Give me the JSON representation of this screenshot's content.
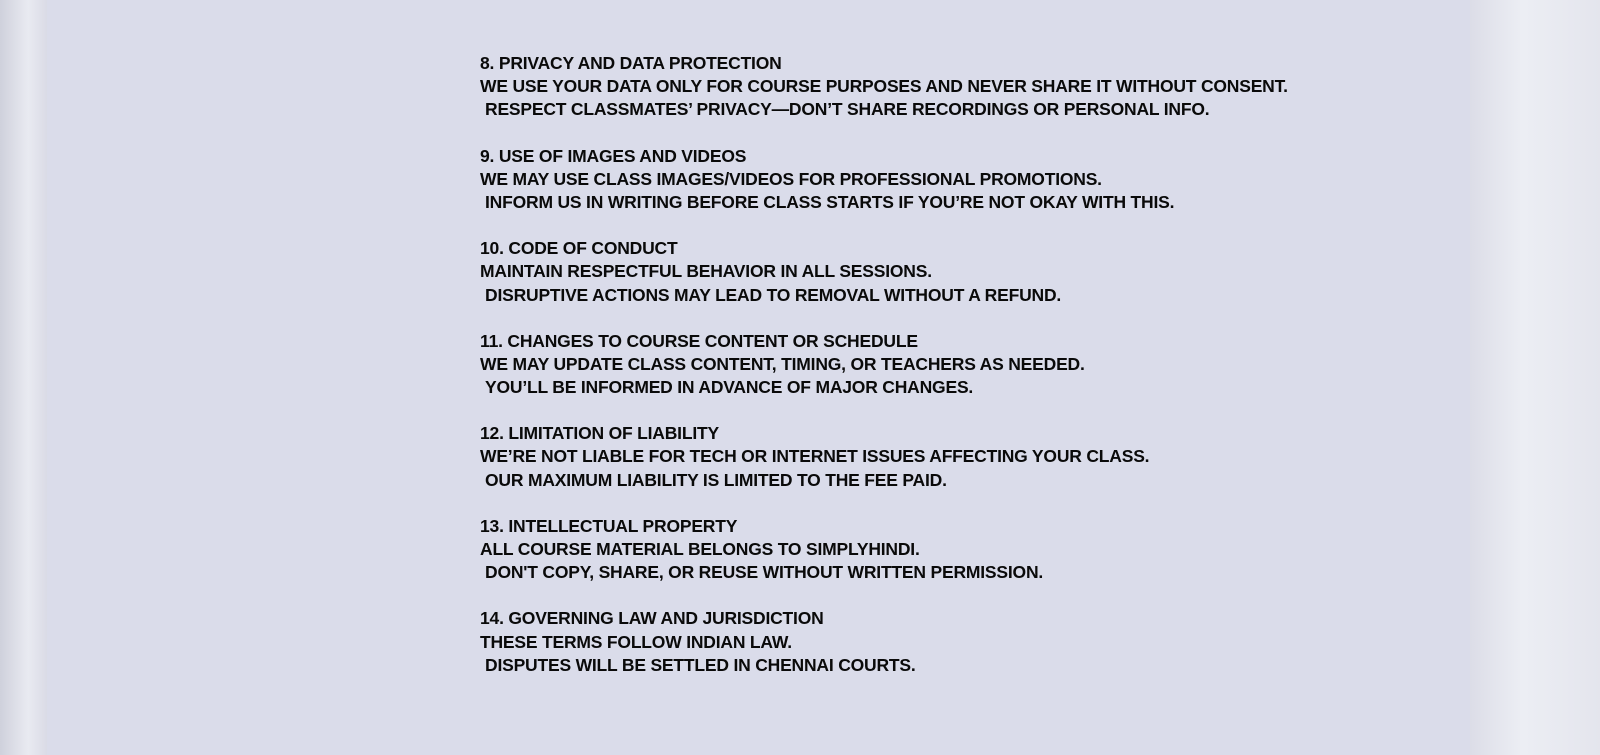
{
  "sections": [
    {
      "heading": "8. PRIVACY AND DATA PROTECTION",
      "line1": "WE USE YOUR DATA ONLY FOR COURSE PURPOSES AND NEVER SHARE IT WITHOUT CONSENT.",
      "line2": "RESPECT CLASSMATES’ PRIVACY—DON’T SHARE RECORDINGS OR PERSONAL INFO."
    },
    {
      "heading": "9. USE OF IMAGES AND VIDEOS",
      "line1": "WE MAY USE CLASS IMAGES/VIDEOS FOR PROFESSIONAL PROMOTIONS.",
      "line2": "INFORM US IN WRITING BEFORE CLASS STARTS IF YOU’RE NOT OKAY WITH THIS."
    },
    {
      "heading": "10. CODE OF CONDUCT",
      "line1": "MAINTAIN RESPECTFUL BEHAVIOR IN ALL SESSIONS.",
      "line2": "DISRUPTIVE ACTIONS MAY LEAD TO REMOVAL WITHOUT A REFUND."
    },
    {
      "heading": "11. CHANGES TO COURSE CONTENT OR SCHEDULE",
      "line1": "WE MAY UPDATE CLASS CONTENT, TIMING, OR TEACHERS AS NEEDED.",
      "line2": "YOU’LL BE INFORMED IN ADVANCE OF MAJOR CHANGES."
    },
    {
      "heading": "12. LIMITATION OF LIABILITY",
      "line1": "WE’RE NOT LIABLE FOR TECH OR INTERNET ISSUES AFFECTING YOUR CLASS.",
      "line2": "OUR MAXIMUM LIABILITY IS LIMITED TO THE FEE PAID."
    },
    {
      "heading": "13. INTELLECTUAL PROPERTY",
      "line1": "ALL COURSE MATERIAL BELONGS TO SIMPLYHINDI.",
      "line2": "DON'T COPY, SHARE, OR REUSE WITHOUT WRITTEN PERMISSION."
    },
    {
      "heading": "14. GOVERNING LAW AND JURISDICTION",
      "line1": "THESE TERMS FOLLOW INDIAN LAW.",
      "line2": "DISPUTES WILL BE SETTLED IN CHENNAI COURTS."
    }
  ]
}
